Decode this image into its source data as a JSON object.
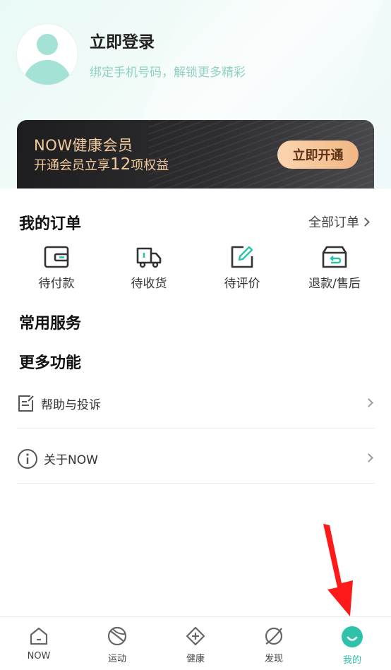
{
  "profile": {
    "title": "立即登录",
    "subtitle": "绑定手机号码，解锁更多精彩"
  },
  "vip": {
    "title": "NOW健康会员",
    "sub_prefix": "开通会员立享",
    "sub_number": "12",
    "sub_suffix": "项权益",
    "button": "立即开通"
  },
  "orders": {
    "title": "我的订单",
    "all_label": "全部订单",
    "items": [
      {
        "label": "待付款",
        "icon": "wallet-icon"
      },
      {
        "label": "待收货",
        "icon": "truck-icon"
      },
      {
        "label": "待评价",
        "icon": "edit-icon"
      },
      {
        "label": "退款/售后",
        "icon": "return-box-icon"
      }
    ]
  },
  "sections": {
    "common_services": "常用服务",
    "more_features": "更多功能"
  },
  "menu": [
    {
      "label": "帮助与投诉",
      "icon": "help-note-icon"
    },
    {
      "label": "关于NOW",
      "icon": "info-icon"
    }
  ],
  "tabbar": [
    {
      "label": "NOW",
      "icon": "home-icon"
    },
    {
      "label": "运动",
      "icon": "ball-icon"
    },
    {
      "label": "健康",
      "icon": "health-plus-icon"
    },
    {
      "label": "发现",
      "icon": "planet-icon"
    },
    {
      "label": "我的",
      "icon": "smile-icon",
      "active": true
    }
  ],
  "colors": {
    "accent": "#2fc2aa",
    "vip_gold": "#f2c99b",
    "annotation_arrow": "#ff1a1a"
  }
}
